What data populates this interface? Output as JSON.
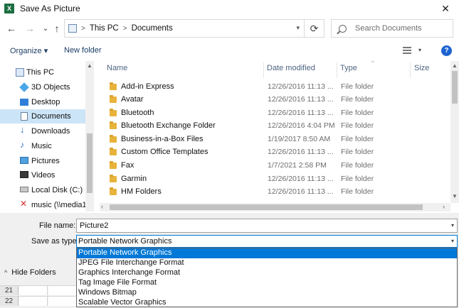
{
  "window": {
    "title": "Save As Picture",
    "app_icon": "excel-icon",
    "close_glyph": "✕"
  },
  "nav_buttons": {
    "back": "←",
    "forward": "→",
    "recent": "⌄",
    "up": "↑"
  },
  "address": {
    "segments": [
      "This PC",
      "Documents"
    ],
    "separator": ">",
    "refresh_glyph": "⟳"
  },
  "search": {
    "placeholder": "Search Documents"
  },
  "toolbar": {
    "organize": "Organize ▾",
    "new_folder": "New folder",
    "help": "?"
  },
  "nav_pane": {
    "items": [
      {
        "label": "This PC",
        "icon": "computer-icon"
      },
      {
        "label": "3D Objects",
        "icon": "cube-icon"
      },
      {
        "label": "Desktop",
        "icon": "desktop-icon"
      },
      {
        "label": "Documents",
        "icon": "document-icon",
        "selected": true
      },
      {
        "label": "Downloads",
        "icon": "download-icon"
      },
      {
        "label": "Music",
        "icon": "music-icon"
      },
      {
        "label": "Pictures",
        "icon": "pictures-icon"
      },
      {
        "label": "Videos",
        "icon": "video-icon"
      },
      {
        "label": "Local Disk (C:)",
        "icon": "drive-icon"
      },
      {
        "label": "music (\\\\media1",
        "icon": "network-drive-icon"
      }
    ]
  },
  "columns": {
    "name": "Name",
    "date": "Date modified",
    "type": "Type",
    "size": "Size"
  },
  "files": [
    {
      "name": "Add-in Express",
      "date": "12/26/2016 11:13 ...",
      "type": "File folder"
    },
    {
      "name": "Avatar",
      "date": "12/26/2016 11:13 ...",
      "type": "File folder"
    },
    {
      "name": "Bluetooth",
      "date": "12/26/2016 11:13 ...",
      "type": "File folder"
    },
    {
      "name": "Bluetooth Exchange Folder",
      "date": "12/26/2016 4:04 PM",
      "type": "File folder"
    },
    {
      "name": "Business-in-a-Box Files",
      "date": "1/19/2017 8:50 AM",
      "type": "File folder"
    },
    {
      "name": "Custom Office Templates",
      "date": "12/26/2016 11:13 ...",
      "type": "File folder"
    },
    {
      "name": "Fax",
      "date": "1/7/2021 2:58 PM",
      "type": "File folder"
    },
    {
      "name": "Garmin",
      "date": "12/26/2016 11:13 ...",
      "type": "File folder"
    },
    {
      "name": "HM Folders",
      "date": "12/26/2016 11:13 ...",
      "type": "File folder"
    }
  ],
  "form": {
    "file_name_label": "File name:",
    "file_name_value": "Picture2",
    "save_type_label": "Save as type:",
    "save_type_value": "Portable Network Graphics",
    "hide_folders": "Hide Folders"
  },
  "type_options": [
    {
      "label": "Portable Network Graphics",
      "selected": true
    },
    {
      "label": "JPEG File Interchange Format"
    },
    {
      "label": "Graphics Interchange Format"
    },
    {
      "label": "Tag Image File Format"
    },
    {
      "label": "Windows Bitmap"
    },
    {
      "label": "Scalable Vector Graphics"
    }
  ],
  "sheet_rows": [
    "21",
    "22"
  ],
  "colors": {
    "accent": "#0078d7",
    "selection": "#cce4f7",
    "folder": "#e8b33a",
    "excel_green": "#1d6f42"
  }
}
